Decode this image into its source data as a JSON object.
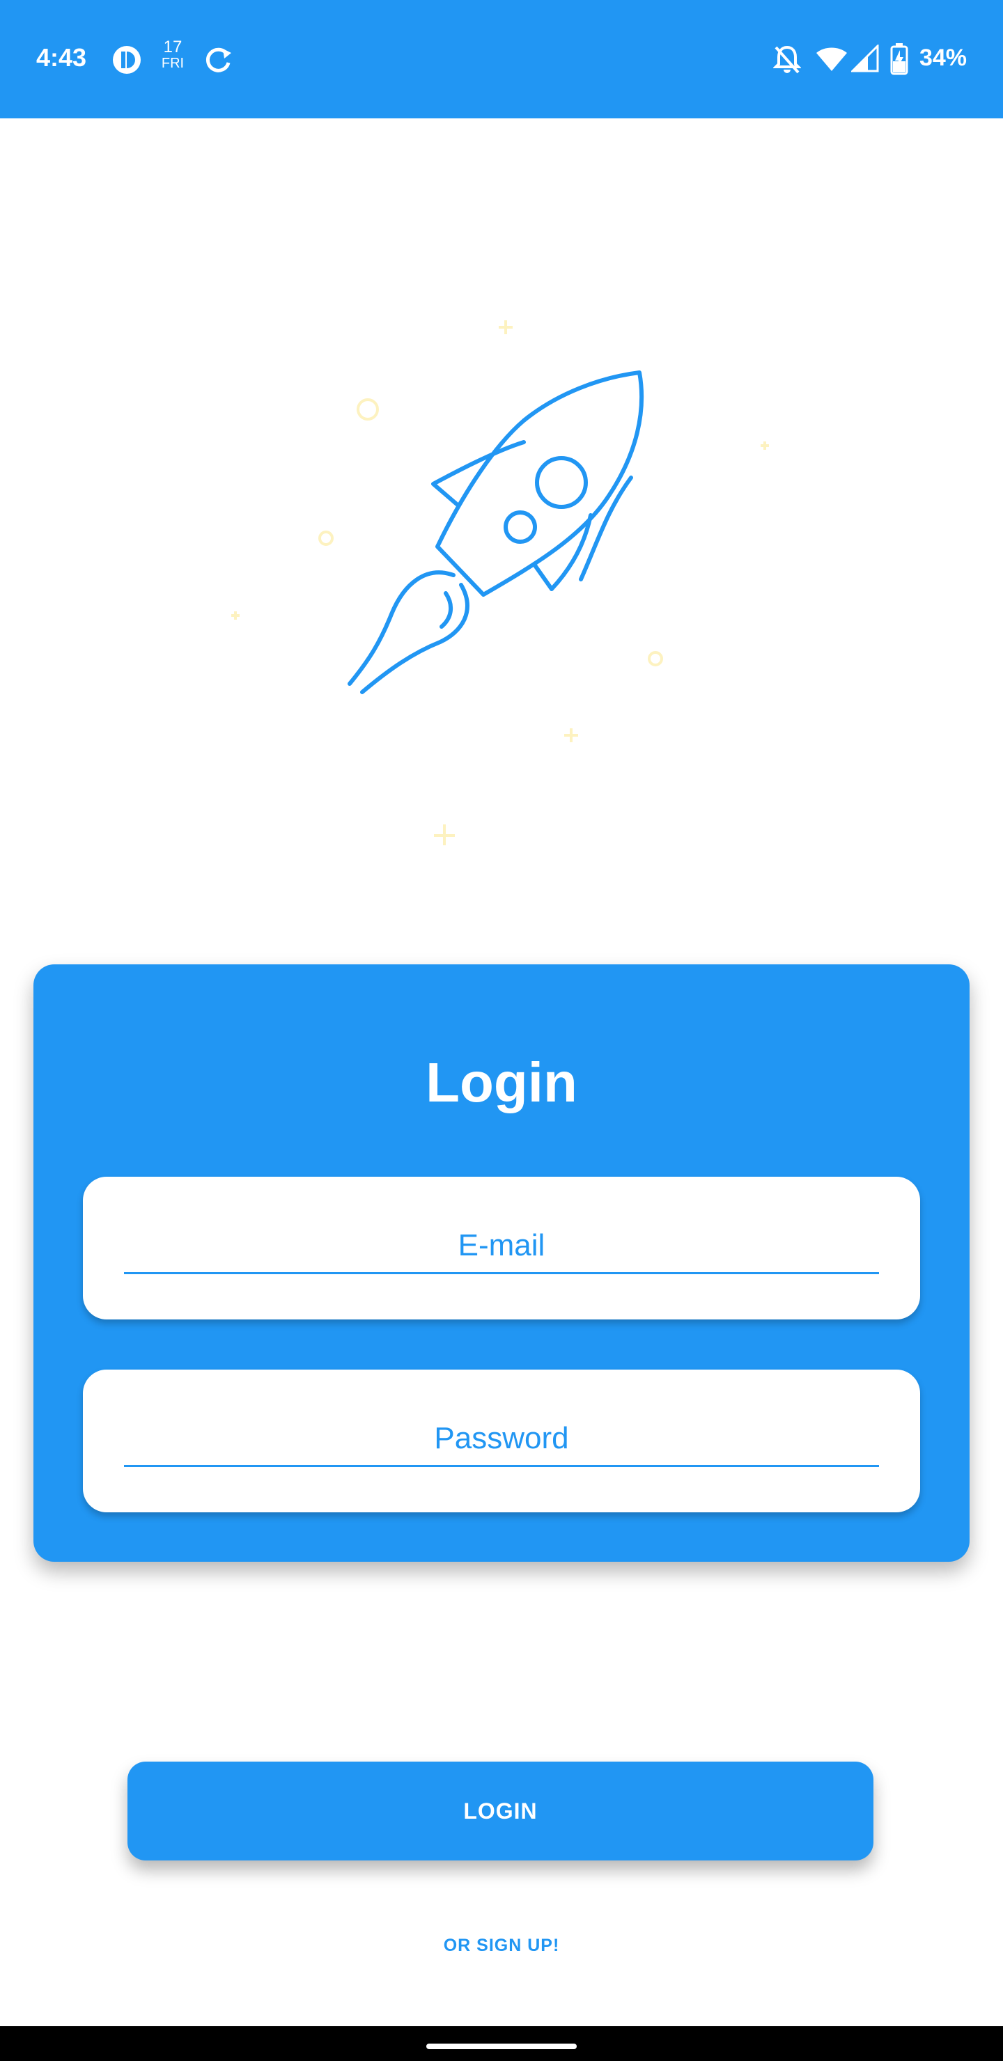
{
  "status_bar": {
    "time": "4:43",
    "date_day": "17",
    "date_weekday": "FRI",
    "battery": "34%",
    "icons": [
      "app-notification-icon",
      "calendar-icon",
      "sync-icon",
      "notifications-off-icon",
      "wifi-icon",
      "cell-signal-icon",
      "battery-charging-icon"
    ]
  },
  "illustration": {
    "icon": "rocket-icon",
    "colors": {
      "rocket": "#2196F3",
      "stars": "#FDF2C0"
    }
  },
  "login_form": {
    "title": "Login",
    "email_placeholder": "E-mail",
    "password_placeholder": "Password"
  },
  "actions": {
    "login_label": "LOGIN",
    "signup_label": "OR SIGN UP!"
  },
  "theme": {
    "primary": "#2196F3",
    "background": "#FFFFFF"
  }
}
